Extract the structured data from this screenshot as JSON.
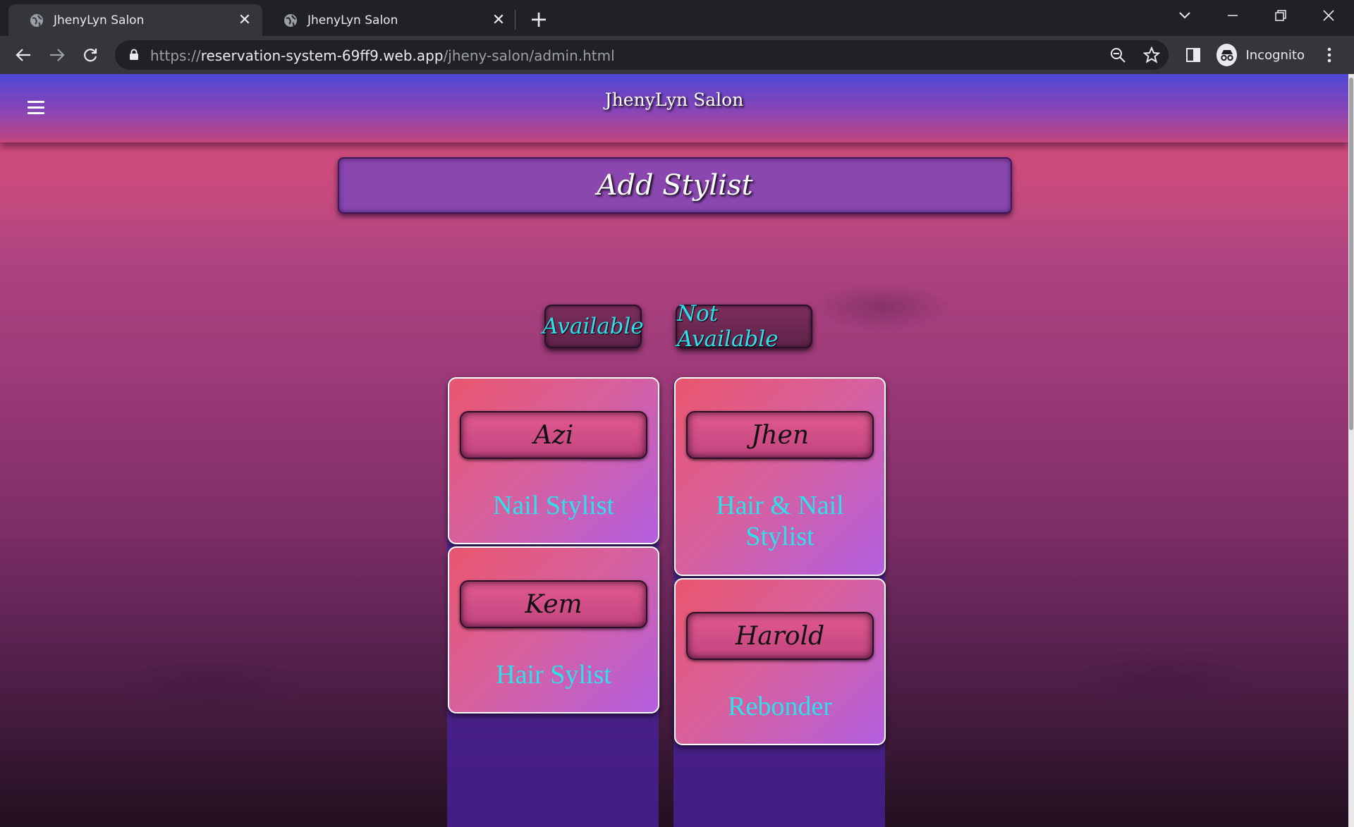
{
  "browser": {
    "tabs": [
      {
        "title": "JhenyLyn Salon",
        "active": true
      },
      {
        "title": "JhenyLyn Salon",
        "active": false
      }
    ],
    "new_tab": "+",
    "url_scheme": "https://",
    "url_host": "reservation-system-69ff9.web.app",
    "url_path": "/jheny-salon/admin.html",
    "profile_label": "Incognito"
  },
  "page": {
    "brand": "JhenyLyn Salon",
    "add_stylist_label": "Add Stylist",
    "filters": {
      "available": "Available",
      "not_available": "Not Available"
    },
    "stylists": [
      {
        "name": "Azi",
        "role": "Nail Stylist"
      },
      {
        "name": "Kem",
        "role": "Hair Sylist"
      },
      {
        "name": "Jhen",
        "role": "Hair & Nail Stylist"
      },
      {
        "name": "Harold",
        "role": "Rebonder"
      }
    ]
  },
  "colors": {
    "accent_text": "#2fe0ea",
    "navbar_start": "#4d46d6",
    "navbar_end": "#c2457c"
  }
}
